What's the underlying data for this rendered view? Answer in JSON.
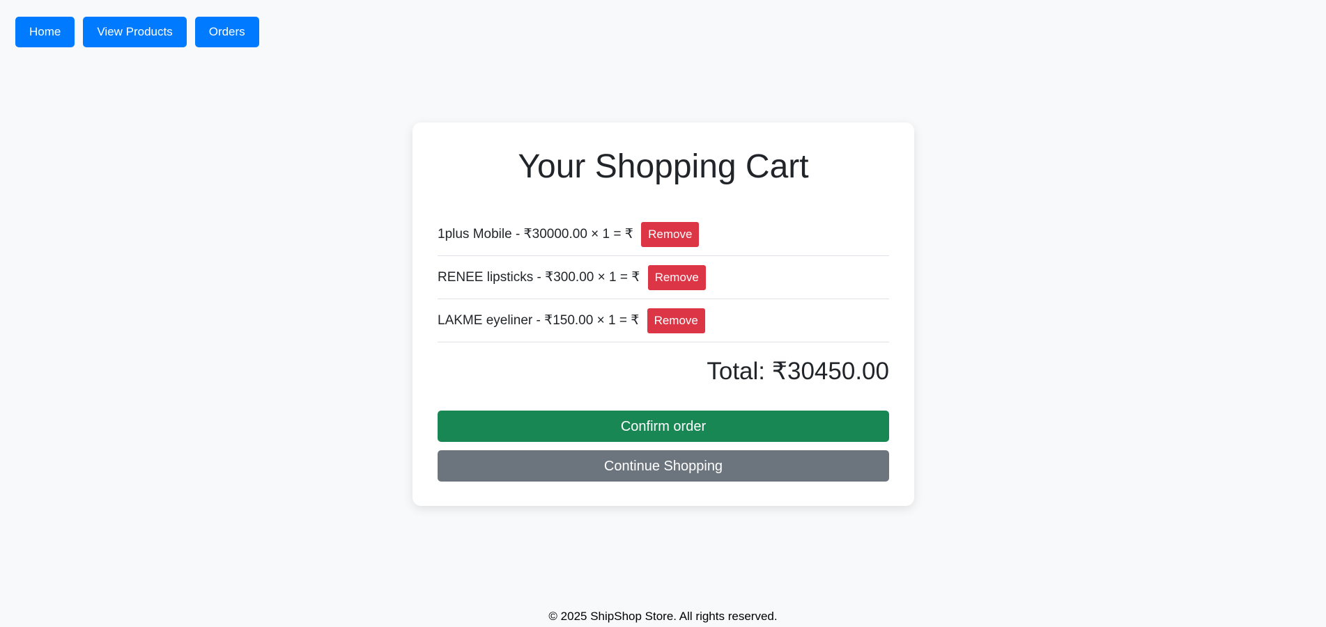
{
  "nav": {
    "home_label": "Home",
    "products_label": "View Products",
    "orders_label": "Orders"
  },
  "cart": {
    "title": "Your Shopping Cart",
    "items": [
      {
        "text": "1plus Mobile - ₹30000.00 × 1 = ₹ ",
        "remove_label": "Remove"
      },
      {
        "text": "RENEE lipsticks - ₹300.00 × 1 = ₹ ",
        "remove_label": "Remove"
      },
      {
        "text": "LAKME eyeliner - ₹150.00 × 1 = ₹ ",
        "remove_label": "Remove"
      }
    ],
    "total": "Total: ₹30450.00",
    "confirm_label": "Confirm order",
    "continue_label": "Continue Shopping"
  },
  "footer": {
    "text": "© 2025 ShipShop Store. All rights reserved."
  },
  "colors": {
    "primary": "#007bff",
    "danger": "#dc3545",
    "success": "#198754",
    "secondary": "#6c757d",
    "background": "#f8f9fa"
  }
}
